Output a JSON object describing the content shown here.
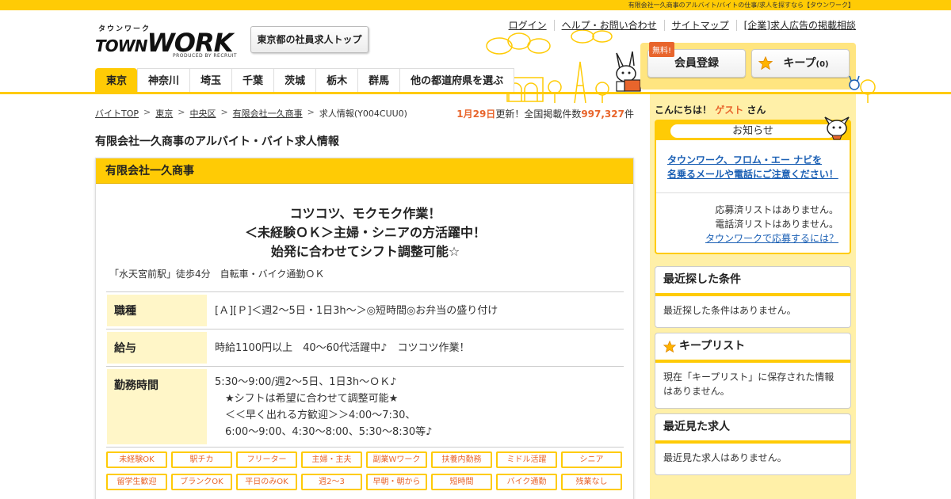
{
  "topbar": {
    "text": "有限会社一久商事のアルバイト/バイトの仕事/求人を探すなら【タウンワーク】"
  },
  "logo": {
    "kana": "タウンワーク",
    "main": "WORK",
    "town": "TOWN",
    "produced": "PRODUCED BY RECRUIT"
  },
  "header": {
    "region_button": "東京都の社員求人トップ",
    "links": [
      "ログイン",
      "ヘルプ・お問い合わせ",
      "サイトマップ",
      "[企業]求人広告の掲載相談"
    ],
    "free_badge": "無料!",
    "member_register": "会員登録",
    "keep_label": "キープ",
    "keep_count": "(0)"
  },
  "nav": {
    "tabs": [
      "東京",
      "神奈川",
      "埼玉",
      "千葉",
      "茨城",
      "栃木",
      "群馬",
      "他の都道府県を選ぶ"
    ],
    "active_index": 0
  },
  "breadcrumb": {
    "items": [
      "バイトTOP",
      "東京",
      "中央区",
      "有限会社一久商事",
      "求人情報(Y004CUU0)"
    ],
    "separator": ">"
  },
  "update": {
    "date": "1月29日",
    "text1": "更新！全国掲載件数",
    "count": "997,327",
    "text2": "件"
  },
  "page_title": "有限会社一久商事のアルバイト・バイト求人情報",
  "job": {
    "company": "有限会社一久商事",
    "catch_lines": [
      "コツコツ、モクモク作業！",
      "＜未経験ＯＫ＞主婦・シニアの方活躍中！",
      "始発に合わせてシフト調整可能☆"
    ],
    "access": "「水天宮前駅」徒歩4分　自転車・バイク通勤ＯＫ",
    "rows": [
      {
        "label": "職種",
        "lines": [
          "[Ａ][Ｐ]＜週2～5日・1日3h～＞◎短時間◎お弁当の盛り付け"
        ]
      },
      {
        "label": "給与",
        "lines": [
          "時給1100円以上　40～60代活躍中♪　コツコツ作業！"
        ]
      },
      {
        "label": "勤務時間",
        "lines": [
          "5:30～9:00/週2～5日、1日3h～ＯＫ♪",
          "　★シフトは希望に合わせて調整可能★",
          "　＜＜早く出れる方歓迎＞＞4:00～7:30、",
          "　6:00～9:00、4:30～8:00、5:30～8:30等♪"
        ]
      }
    ],
    "tags": [
      "未経験OK",
      "駅チカ",
      "フリーター",
      "主婦・主夫",
      "副業Wワーク",
      "扶養内勤務",
      "ミドル活躍",
      "シニア",
      "留学生歓迎",
      "ブランクOK",
      "平日のみOK",
      "週2～3",
      "早朝・朝から",
      "短時間",
      "バイク通勤",
      "残業なし"
    ]
  },
  "sidebar": {
    "greet_prefix": "こんにちは！",
    "guest": "ゲスト",
    "greet_suffix": "さん",
    "notice_title": "お知らせ",
    "notice_link_lines": [
      "タウンワーク、フロム・エー ナビを",
      "名乗るメールや電話にご注意ください！"
    ],
    "notice_lines": [
      "応募済リストはありません。",
      "電話済リストはありません。"
    ],
    "notice_howto": "タウンワークで応募するには？",
    "recent_search_title": "最近探した条件",
    "recent_search_body": "最近探した条件はありません。",
    "keep_list_title": "キープリスト",
    "keep_list_body": "現在「キープリスト」に保存された情報はありません。",
    "recent_view_title": "最近見た求人",
    "recent_view_body": "最近見た求人はありません。"
  },
  "colors": {
    "brand_yellow": "#ffcb05",
    "accent_orange": "#e8652c",
    "link_blue": "#1a5fb4",
    "sidebar_bg": "#fff0a8"
  }
}
